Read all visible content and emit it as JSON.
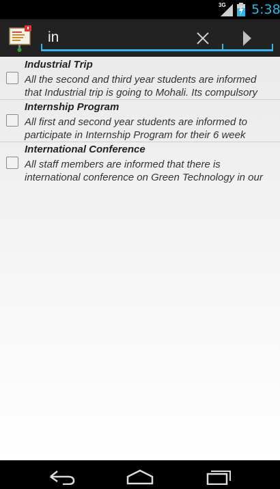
{
  "status_bar": {
    "network_type": "3G",
    "time": "5:38"
  },
  "action_bar": {
    "search": {
      "value": "in",
      "placeholder": ""
    }
  },
  "notices": [
    {
      "title": "Industrial Trip",
      "description": "All the second and third year students are informed that Industrial trip is going to Mohali. Its compulsory",
      "checked": false
    },
    {
      "title": "Internship Program",
      "description": "All first and second year students are informed to participate in Internship Program for their 6 week",
      "checked": false
    },
    {
      "title": "International Conference",
      "description": "All staff members are informed that there is international conference on Green Technology in our",
      "checked": false
    }
  ],
  "colors": {
    "accent": "#33b5e5",
    "action_bar": "#222222",
    "nav_bar": "#000000"
  },
  "icons": {
    "app": "notice-board-icon",
    "clear": "close-icon",
    "go": "play-arrow-icon",
    "back": "back-icon",
    "home": "home-icon",
    "recents": "recents-icon"
  }
}
